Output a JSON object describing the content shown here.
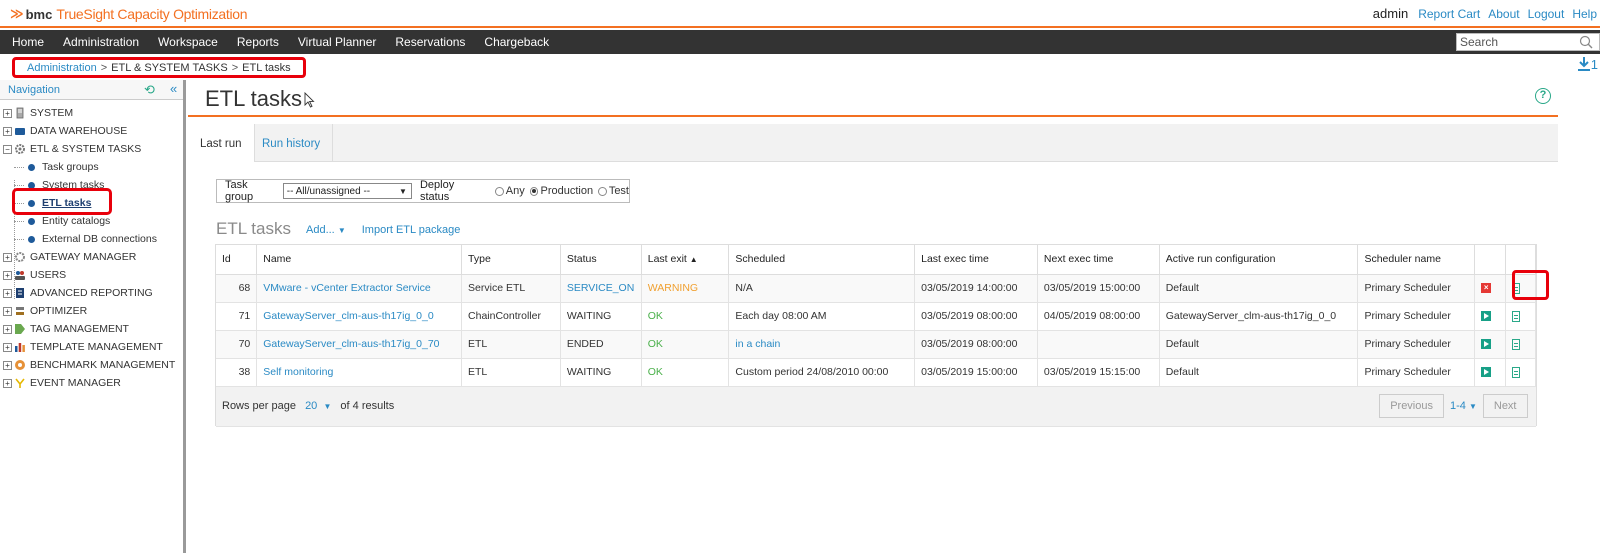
{
  "header": {
    "logo_mark": "≫",
    "logo_bmc": "bmc",
    "product": "TrueSight Capacity Optimization",
    "user": "admin",
    "links": [
      "Report Cart",
      "About",
      "Logout",
      "Help"
    ]
  },
  "nav": {
    "items": [
      "Home",
      "Administration",
      "Workspace",
      "Reports",
      "Virtual Planner",
      "Reservations",
      "Chargeback"
    ],
    "search_placeholder": "Search"
  },
  "breadcrumb": {
    "items": [
      "Administration",
      "ETL & SYSTEM TASKS",
      "ETL tasks"
    ],
    "separator": ">"
  },
  "download_count": "1",
  "sidebar": {
    "title": "Navigation",
    "tree": [
      {
        "label": "SYSTEM",
        "icon": "server-icon"
      },
      {
        "label": "DATA WAREHOUSE",
        "icon": "database-icon"
      },
      {
        "label": "ETL & SYSTEM TASKS",
        "icon": "gears-icon",
        "expanded": true,
        "children": [
          "Task groups",
          "System tasks",
          "ETL tasks",
          "Entity catalogs",
          "External DB connections"
        ]
      },
      {
        "label": "GATEWAY MANAGER",
        "icon": "gear-icon"
      },
      {
        "label": "USERS",
        "icon": "users-icon"
      },
      {
        "label": "ADVANCED REPORTING",
        "icon": "report-icon"
      },
      {
        "label": "OPTIMIZER",
        "icon": "optimizer-icon"
      },
      {
        "label": "TAG MANAGEMENT",
        "icon": "tag-icon"
      },
      {
        "label": "TEMPLATE MANAGEMENT",
        "icon": "template-icon"
      },
      {
        "label": "BENCHMARK MANAGEMENT",
        "icon": "benchmark-icon"
      },
      {
        "label": "EVENT MANAGER",
        "icon": "event-icon"
      }
    ],
    "active_child": "ETL tasks"
  },
  "page": {
    "title": "ETL tasks",
    "tabs": [
      "Last run",
      "Run history"
    ],
    "filter": {
      "task_group_label": "Task group",
      "task_group_value": "-- All/unassigned --",
      "deploy_label": "Deploy status",
      "deploy_options": [
        "Any",
        "Production",
        "Test"
      ],
      "deploy_selected": "Production"
    },
    "section_title": "ETL tasks",
    "add_label": "Add...",
    "import_label": "Import ETL package"
  },
  "table": {
    "columns": [
      "Id",
      "Name",
      "Type",
      "Status",
      "Last exit",
      "Scheduled",
      "Last exec time",
      "Next exec time",
      "Active run configuration",
      "Scheduler name"
    ],
    "sort_column": "Last exit",
    "rows": [
      {
        "id": "68",
        "name": "VMware - vCenter Extractor Service",
        "type": "Service ETL",
        "status": "SERVICE_ON",
        "last_exit": "WARNING",
        "scheduled": "N/A",
        "last_exec": "03/05/2019 14:00:00",
        "next_exec": "03/05/2019 15:00:00",
        "run_config": "Default",
        "scheduler": "Primary Scheduler",
        "action": "stop"
      },
      {
        "id": "71",
        "name": "GatewayServer_clm-aus-th17ig_0_0",
        "type": "ChainController",
        "status": "WAITING",
        "last_exit": "OK",
        "scheduled": "Each day 08:00 AM",
        "last_exec": "03/05/2019 08:00:00",
        "next_exec": "04/05/2019 08:00:00",
        "run_config": "GatewayServer_clm-aus-th17ig_0_0",
        "scheduler": "Primary Scheduler",
        "action": "run"
      },
      {
        "id": "70",
        "name": "GatewayServer_clm-aus-th17ig_0_70",
        "type": "ETL",
        "status": "ENDED",
        "last_exit": "OK",
        "scheduled": "in a chain",
        "last_exec": "03/05/2019 08:00:00",
        "next_exec": "",
        "run_config": "Default",
        "scheduler": "Primary Scheduler",
        "action": "run"
      },
      {
        "id": "38",
        "name": "Self monitoring",
        "type": "ETL",
        "status": "WAITING",
        "last_exit": "OK",
        "scheduled": "Custom period 24/08/2010 00:00",
        "last_exec": "03/05/2019 15:00:00",
        "next_exec": "03/05/2019 15:15:00",
        "run_config": "Default",
        "scheduler": "Primary Scheduler",
        "action": "run"
      }
    ],
    "footer": {
      "rows_per_page_label": "Rows per page",
      "rows_per_page_value": "20",
      "results_label": "of 4 results",
      "previous": "Previous",
      "range": "1-4",
      "next": "Next"
    }
  },
  "colors": {
    "accent_orange": "#f37021",
    "link_blue": "#2a8ac4",
    "highlight_red": "#e8000b",
    "navbar": "#333333"
  }
}
